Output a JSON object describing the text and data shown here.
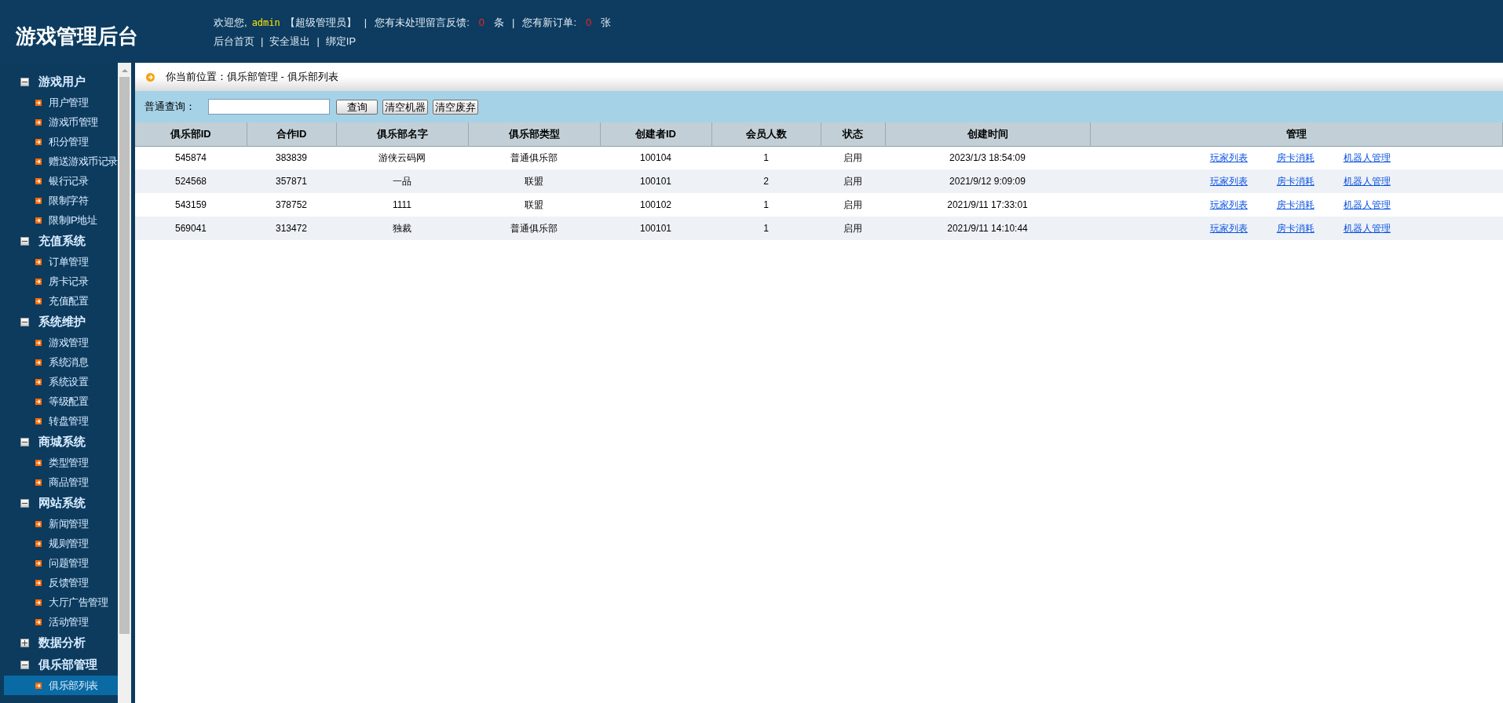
{
  "app_title": "游戏管理后台",
  "welcome": [
    {
      "kind": "text",
      "text": "欢迎您,"
    },
    {
      "kind": "user",
      "text": "admin"
    },
    {
      "kind": "text",
      "text": "【超级管理员】"
    },
    {
      "kind": "sep",
      "text": "|"
    },
    {
      "kind": "text",
      "text": "您有未处理留言反馈:"
    },
    {
      "kind": "count",
      "text": "0"
    },
    {
      "kind": "text",
      "text": "条"
    },
    {
      "kind": "sep",
      "text": "|"
    },
    {
      "kind": "text",
      "text": "您有新订单:"
    },
    {
      "kind": "count",
      "text": "0"
    },
    {
      "kind": "text",
      "text": "张"
    }
  ],
  "top_nav": [
    {
      "kind": "link",
      "text": "后台首页"
    },
    {
      "kind": "sep",
      "text": "|"
    },
    {
      "kind": "link",
      "text": "安全退出"
    },
    {
      "kind": "sep",
      "text": "|"
    },
    {
      "kind": "link",
      "text": "绑定IP"
    }
  ],
  "sidebar": {
    "groups": [
      {
        "label": "游戏用户",
        "expanded": true,
        "items": [
          {
            "label": "用户管理",
            "selected": false
          },
          {
            "label": "游戏币管理",
            "selected": false
          },
          {
            "label": "积分管理",
            "selected": false
          },
          {
            "label": "赠送游戏币记录",
            "selected": false
          },
          {
            "label": "银行记录",
            "selected": false
          },
          {
            "label": "限制字符",
            "selected": false
          },
          {
            "label": "限制IP地址",
            "selected": false
          }
        ]
      },
      {
        "label": "充值系统",
        "expanded": true,
        "items": [
          {
            "label": "订单管理",
            "selected": false
          },
          {
            "label": "房卡记录",
            "selected": false
          },
          {
            "label": "充值配置",
            "selected": false
          }
        ]
      },
      {
        "label": "系统维护",
        "expanded": true,
        "items": [
          {
            "label": "游戏管理",
            "selected": false
          },
          {
            "label": "系统消息",
            "selected": false
          },
          {
            "label": "系统设置",
            "selected": false
          },
          {
            "label": "等级配置",
            "selected": false
          },
          {
            "label": "转盘管理",
            "selected": false
          }
        ]
      },
      {
        "label": "商城系统",
        "expanded": true,
        "items": [
          {
            "label": "类型管理",
            "selected": false
          },
          {
            "label": "商品管理",
            "selected": false
          }
        ]
      },
      {
        "label": "网站系统",
        "expanded": true,
        "items": [
          {
            "label": "新闻管理",
            "selected": false
          },
          {
            "label": "规则管理",
            "selected": false
          },
          {
            "label": "问题管理",
            "selected": false
          },
          {
            "label": "反馈管理",
            "selected": false
          },
          {
            "label": "大厅广告管理",
            "selected": false
          },
          {
            "label": "活动管理",
            "selected": false
          }
        ]
      },
      {
        "label": "数据分析",
        "expanded": false
      },
      {
        "label": "俱乐部管理",
        "expanded": true,
        "items": [
          {
            "label": "俱乐部列表",
            "selected": true
          }
        ]
      }
    ]
  },
  "breadcrumb": "你当前位置：俱乐部管理 - 俱乐部列表",
  "search": {
    "label": "普通查询：",
    "buttons": [
      "查询",
      "清空机器",
      "清空废弃"
    ]
  },
  "table": {
    "columns": [
      "俱乐部ID",
      "合作ID",
      "俱乐部名字",
      "俱乐部类型",
      "创建者ID",
      "会员人数",
      "状态",
      "创建时间",
      "管理"
    ],
    "rows": [
      {
        "cells": [
          "545874",
          "383839",
          "游侠云码网",
          "普通俱乐部",
          "100104",
          "1",
          "启用",
          "2023/1/3 18:54:09"
        ],
        "actions": [
          "玩家列表",
          "房卡消耗",
          "机器人管理"
        ]
      },
      {
        "cells": [
          "524568",
          "357871",
          "一品",
          "联盟",
          "100101",
          "2",
          "启用",
          "2021/9/12 9:09:09"
        ],
        "actions": [
          "玩家列表",
          "房卡消耗",
          "机器人管理"
        ]
      },
      {
        "cells": [
          "543159",
          "378752",
          "1111",
          "联盟",
          "100102",
          "1",
          "启用",
          "2021/9/11 17:33:01"
        ],
        "actions": [
          "玩家列表",
          "房卡消耗",
          "机器人管理"
        ]
      },
      {
        "cells": [
          "569041",
          "313472",
          "独裁",
          "普通俱乐部",
          "100101",
          "1",
          "启用",
          "2021/9/11 14:10:44"
        ],
        "actions": [
          "玩家列表",
          "房卡消耗",
          "机器人管理"
        ]
      }
    ]
  }
}
